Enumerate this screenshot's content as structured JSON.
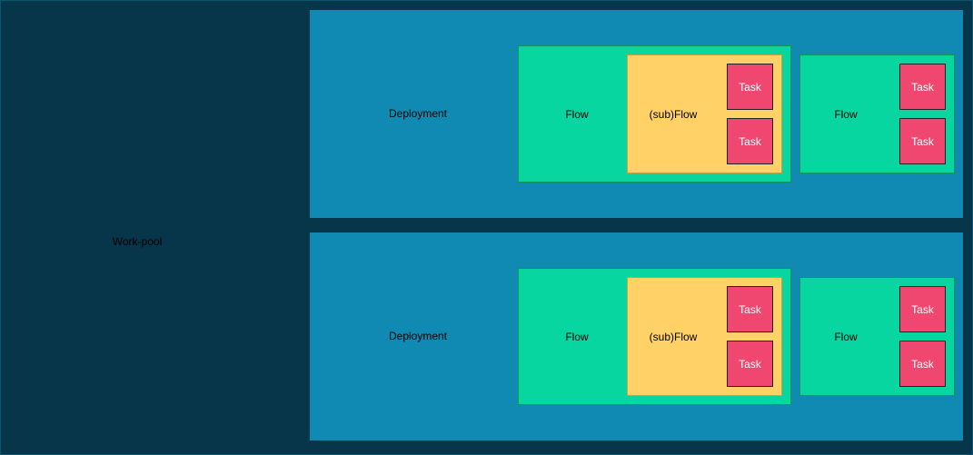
{
  "workpool": {
    "label": "Work-pool"
  },
  "deployments": [
    {
      "label": "Deployment",
      "flows": [
        {
          "label": "Flow",
          "subflow": {
            "label": "(sub)Flow",
            "tasks": [
              "Task",
              "Task"
            ]
          }
        },
        {
          "label": "Flow",
          "tasks": [
            "Task",
            "Task"
          ]
        }
      ]
    },
    {
      "label": "Deployment",
      "flows": [
        {
          "label": "Flow",
          "subflow": {
            "label": "(sub)Flow",
            "tasks": [
              "Task",
              "Task"
            ]
          }
        },
        {
          "label": "Flow",
          "tasks": [
            "Task",
            "Task"
          ]
        }
      ]
    }
  ],
  "colors": {
    "workpool": "#07364a",
    "deployment": "#108ab3",
    "flow": "#07d6a0",
    "subflow": "#ffd166",
    "task": "#ef476f"
  }
}
